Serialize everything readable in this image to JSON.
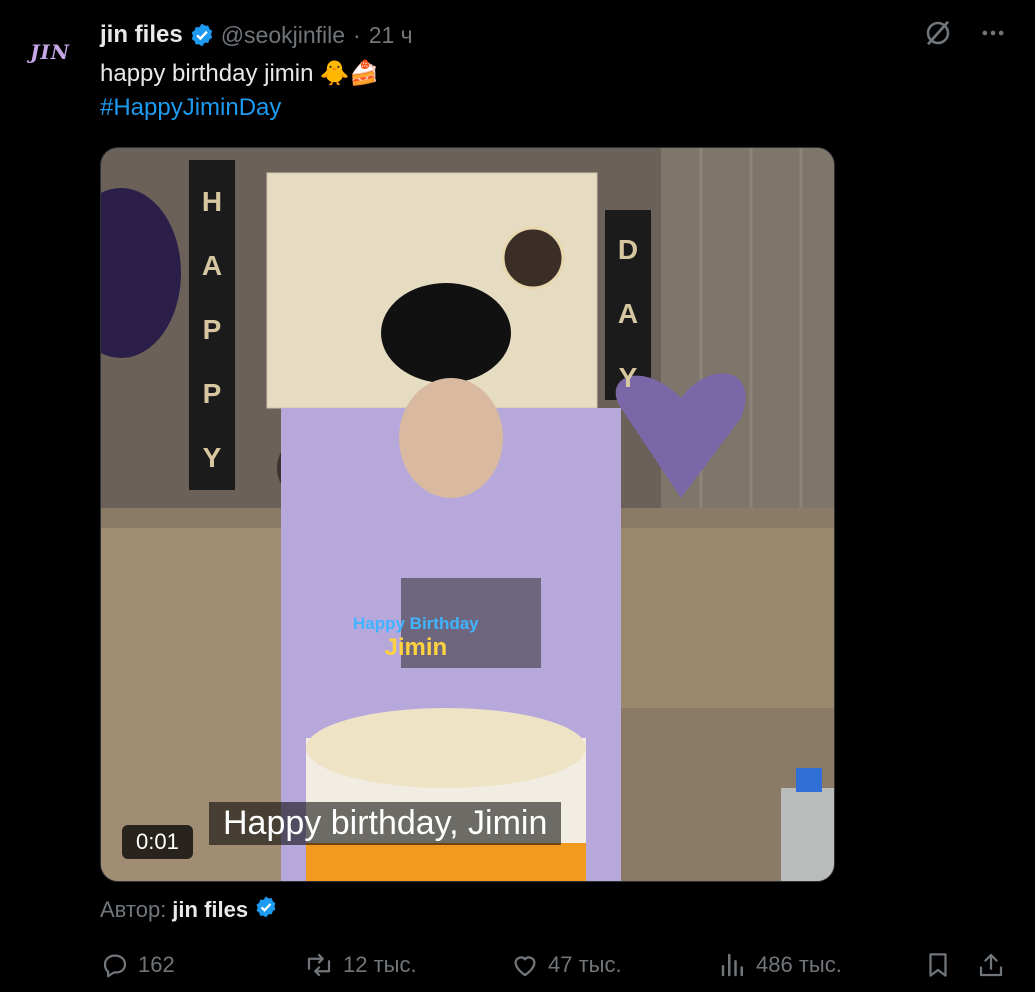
{
  "author": {
    "avatar_text": "JIN",
    "name": "jin files",
    "handle": "@seokjinfile",
    "separator": "·",
    "time": "21 ч"
  },
  "tweet": {
    "text": "happy birthday jimin",
    "emojis": "🐥🍰",
    "hashtag": "#HappyJiminDay"
  },
  "media": {
    "duration": "0:01",
    "subtitle": "Happy birthday, Jimin",
    "banner_left": [
      "H",
      "A",
      "P",
      "P",
      "Y"
    ],
    "banner_right": [
      "D",
      "A",
      "Y"
    ],
    "sticker_line1": "Happy Birthday",
    "sticker_line2": "Jimin"
  },
  "attribution": {
    "prefix": "Автор:",
    "name": "jin files"
  },
  "actions": {
    "replies": "162",
    "reposts": "12 тыс.",
    "likes": "47 тыс.",
    "views": "486 тыс."
  },
  "colors": {
    "accent": "#1d9bf0",
    "muted": "#71767b",
    "text": "#e7e9ea",
    "background": "#000000"
  },
  "icons": [
    "grok-icon",
    "more-icon",
    "verified-icon",
    "reply-icon",
    "repost-icon",
    "like-icon",
    "views-icon",
    "bookmark-icon",
    "share-icon"
  ]
}
